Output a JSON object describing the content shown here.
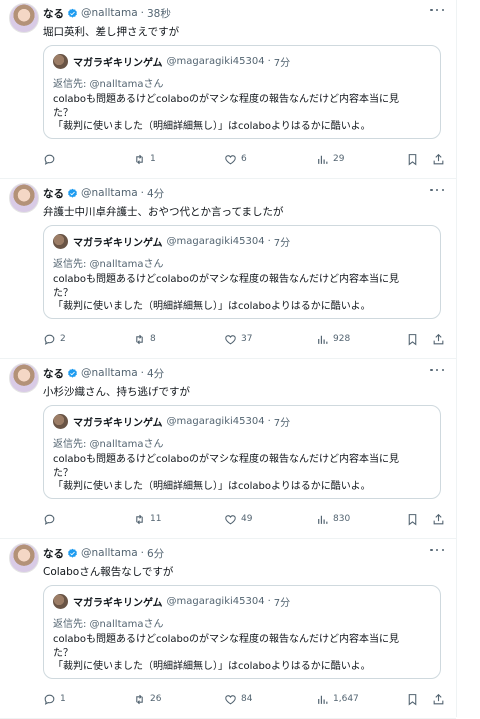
{
  "quoted": {
    "name": "マガラギキリンゲム",
    "handle": "@magaragiki45304",
    "time": "7分",
    "reply_to": "返信先: @nalltamaさん",
    "text_line1": "colaboも問題あるけどcolaboのがマシな程度の報告なんだけど内容本当に見",
    "text_line2": "た？",
    "text_line3": "「裁判に使いました（明細詳細無し）」はcolaboよりはるかに酷いよ。"
  },
  "tweets": [
    {
      "name": "なる",
      "handle": "@nalltama",
      "time": "38秒",
      "text": "堀口英利、差し押さえですが",
      "reply_count": "",
      "retweet_count": "1",
      "like_count": "6",
      "view_count": "29"
    },
    {
      "name": "なる",
      "handle": "@nalltama",
      "time": "4分",
      "text": "弁護士中川卓弁護士、おやつ代とか言ってましたが",
      "reply_count": "2",
      "retweet_count": "8",
      "like_count": "37",
      "view_count": "928"
    },
    {
      "name": "なる",
      "handle": "@nalltama",
      "time": "4分",
      "text": "小杉沙織さん、持ち逃げですが",
      "reply_count": "",
      "retweet_count": "11",
      "like_count": "49",
      "view_count": "830"
    },
    {
      "name": "なる",
      "handle": "@nalltama",
      "time": "6分",
      "text": "Colaboさん報告なしですが",
      "reply_count": "1",
      "retweet_count": "26",
      "like_count": "84",
      "view_count": "1,647"
    }
  ],
  "colors": {
    "verified": "#1d9bf0",
    "secondary_text": "#536471",
    "border": "#cfd9de"
  },
  "icons": [
    "verified-badge-icon",
    "more-icon",
    "reply-icon",
    "retweet-icon",
    "like-icon",
    "views-icon",
    "bookmark-icon",
    "share-icon"
  ]
}
